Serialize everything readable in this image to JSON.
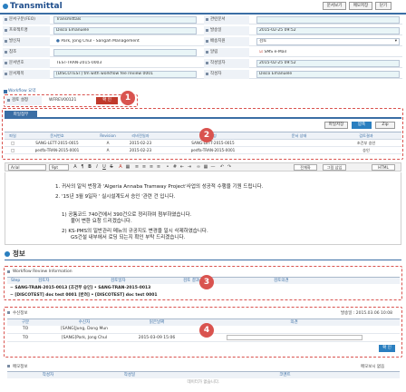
{
  "header": {
    "title": "Transmittal",
    "buttons": [
      "문서보기",
      "메모저장",
      "닫기"
    ]
  },
  "form": {
    "rows": [
      {
        "l1": "문서구분(FEO)",
        "v1": "Transmittals",
        "l2": "관련문서",
        "v2": ""
      },
      {
        "l1": "프로젝트명",
        "v1": "Disco Emanuele",
        "l2": "발송일",
        "v2": "2015-02-25 09:52"
      },
      {
        "l1": "발신처",
        "v1": "Park, Jong Chul - Sangah Management",
        "l2": "배송지원",
        "v2": "검토"
      },
      {
        "l1": "참조",
        "v1": "",
        "l2": "알림",
        "v2": "SMS   e-Mail"
      },
      {
        "l1": "문서번호",
        "v1": "TEST-TRAN-2015-0003",
        "l2": "작성일자",
        "v2": "2015-02-25 09:52"
      },
      {
        "l1": "문서제목",
        "v1": "[DISCOTEST] tm with workflow fee review 0001",
        "l2": "작성자",
        "v2": "Disco Emanuele"
      }
    ]
  },
  "workflow": {
    "section_label": "Workflow 요약",
    "row_label": "검토 설정",
    "code": "WFREV00121",
    "button": "확 인"
  },
  "attachments": {
    "tab": "파일첨부",
    "buttons": [
      "파일저장",
      "압축",
      "Zip"
    ],
    "columns": [
      "파일",
      "문서번호",
      "Revision",
      "리비전일자",
      "형성",
      "문서 상태",
      "검토결과"
    ],
    "rows": [
      [
        "□",
        "SANG-LETT-2015-0015",
        "A",
        "2015-02-23",
        "SANG-LETT-2015-0015",
        "",
        "조건부 승인"
      ],
      [
        "□",
        "pedfa-TRAN-2015-0001",
        "A",
        "2015-02-23",
        "pedfa-TRAN-2015-0001",
        "",
        "승인"
      ]
    ]
  },
  "editor": {
    "font": "Arial",
    "size": "9pt",
    "buttons": [
      "전체화",
      "그림 삽입",
      "HTML"
    ],
    "lines": [
      "1. 귀사의 일익 번창과 'Algeria Annaba Tramway Project'사업의 성공적 수행을 기원 드립니다.",
      "2. '15년 3월 9일자 ' 실시설계도서 승인 '관련 건 입니다.",
      "1) 공통코드 740건에서 390건으로 정리하여 첨부하였습니다.",
      "불어 변환 요청 드리겠습니다.",
      "2) KS-PMS의 일반관리 메뉴의 규공지도 변경을 일시 삭제하였습니다.",
      "GS건설 내부에서 로딩 되는지 확인 부탁 드리겠습니다."
    ]
  },
  "info": {
    "title": "정보",
    "review": {
      "title": "Workflow Review Information",
      "columns": [
        "Step",
        "검토자",
        "검토일자",
        "검토 결과",
        "검토의견"
      ],
      "rows": [
        "SANG-TRAN-2015-0013 [조건부 승인] • SANG-TRAN-2015-0013",
        "[DISCOTEST] doc test 0001 [반려] • [DISCOTEST] doc test 0001"
      ]
    },
    "receivers": {
      "title": "수신정보",
      "date_label": "발송일 : 2015.03.06 10:08",
      "columns": [
        "구분",
        "수신자",
        "읽은날짜",
        "의견"
      ],
      "rows": [
        {
          "type": "TO",
          "name": "[SANG]Jung, Dong Mun",
          "date": ""
        },
        {
          "type": "TO",
          "name": "[SANG]Park, Jong Chul",
          "date": "2015-03-09 15:06"
        }
      ],
      "button": "확 인"
    },
    "comments": {
      "title": "메모정보",
      "right_label": "메모보시 없음",
      "columns": [
        "작성자",
        "작성일",
        "코멘트"
      ],
      "empty": "데이터가 없습니다."
    }
  },
  "callouts": [
    "1",
    "2",
    "3",
    "4"
  ]
}
